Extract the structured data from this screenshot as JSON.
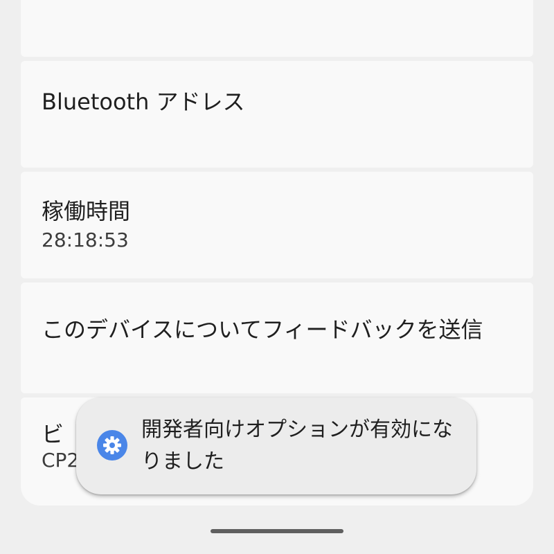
{
  "list": {
    "bluetooth_title": "Bluetooth アドレス",
    "uptime_title": "稼働時間",
    "uptime_value": "28:18:53",
    "feedback_title": "このデバイスについてフィードバックを送信",
    "build_title_partial": "ビ",
    "build_value_partial": "CP2"
  },
  "toast": {
    "message": "開発者向けオプションが有効になりました",
    "icon": "settings-gear-icon",
    "icon_color": "#4a86e8"
  }
}
